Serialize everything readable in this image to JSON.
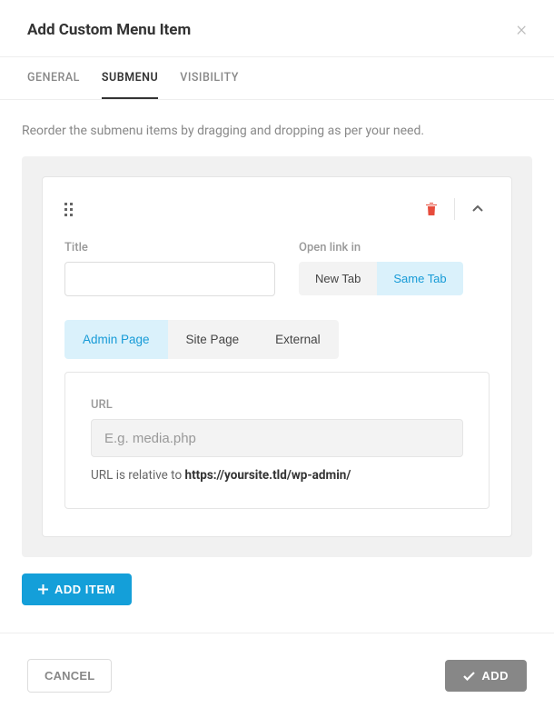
{
  "header": {
    "title": "Add Custom Menu Item"
  },
  "tabs": {
    "general": "GENERAL",
    "submenu": "SUBMENU",
    "visibility": "VISIBILITY"
  },
  "helper": "Reorder the submenu items by dragging and dropping as per your need.",
  "item": {
    "title_label": "Title",
    "title_value": "",
    "open_in_label": "Open link in",
    "open_in_new": "New Tab",
    "open_in_same": "Same Tab",
    "type_admin": "Admin Page",
    "type_site": "Site Page",
    "type_external": "External",
    "url_label": "URL",
    "url_placeholder": "E.g. media.php",
    "url_value": "",
    "url_hint_prefix": "URL is relative to ",
    "url_hint_bold": "https://yoursite.tld/wp-admin/"
  },
  "buttons": {
    "add_item": "ADD ITEM",
    "cancel": "CANCEL",
    "add": "ADD"
  }
}
